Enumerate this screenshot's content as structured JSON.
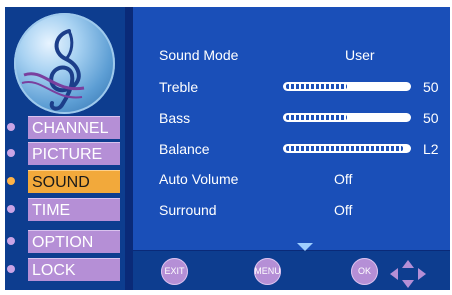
{
  "sidebar": {
    "items": [
      {
        "label": "CHANNEL",
        "active": false
      },
      {
        "label": "PICTURE",
        "active": false
      },
      {
        "label": "SOUND",
        "active": true
      },
      {
        "label": "TIME",
        "active": false
      },
      {
        "label": "OPTION",
        "active": false
      },
      {
        "label": "LOCK",
        "active": false
      }
    ]
  },
  "sound": {
    "mode_label": "Sound Mode",
    "mode_value": "User",
    "treble_label": "Treble",
    "treble_value": "50",
    "bass_label": "Bass",
    "bass_value": "50",
    "balance_label": "Balance",
    "balance_value": "L2",
    "auto_volume_label": "Auto Volume",
    "auto_volume_value": "Off",
    "surround_label": "Surround",
    "surround_value": "Off",
    "treble_level": 0.5,
    "bass_level": 0.5,
    "balance_level": 0.96
  },
  "footer": {
    "exit_label": "EXIT",
    "menu_label": "MENU",
    "ok_label": "OK"
  },
  "icons": [
    "music-clef-icon",
    "down-arrow-icon",
    "dpad-icon"
  ],
  "colors": {
    "active": "#f2a93b",
    "inactive": "#b58fd6",
    "panel": "#1a4fb8"
  }
}
